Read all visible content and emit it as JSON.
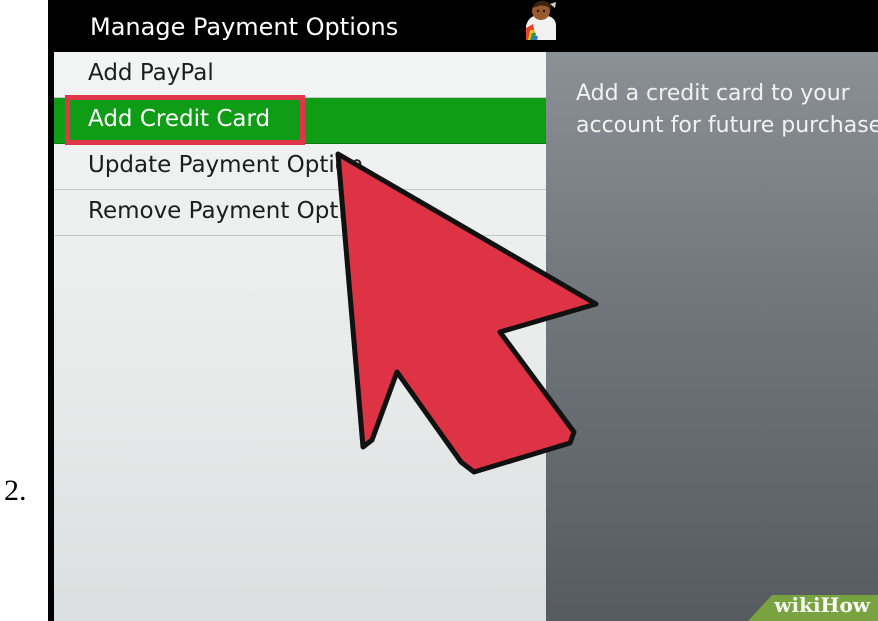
{
  "step": {
    "number": "2."
  },
  "header": {
    "title": "Manage Payment Options",
    "avatar_icon": "gamerpic-avatar-icon"
  },
  "menu": {
    "items": [
      {
        "label": "Add PayPal",
        "selected": false
      },
      {
        "label": "Add Credit Card",
        "selected": true
      },
      {
        "label": "Update Payment Option",
        "selected": false
      },
      {
        "label": "Remove Payment Option",
        "selected": false
      }
    ]
  },
  "info": {
    "line1": "Add a credit card to your",
    "line2": "account for future purchases."
  },
  "annotation": {
    "arrow_icon": "pointer-arrow-icon",
    "highlight_color": "#e0364a"
  },
  "watermark": {
    "text_prefix": "wiki",
    "text_suffix": "How"
  },
  "colors": {
    "selected_bg": "#0f9d16",
    "title_bar": "#000000",
    "arrow_fill": "#dd3344"
  }
}
